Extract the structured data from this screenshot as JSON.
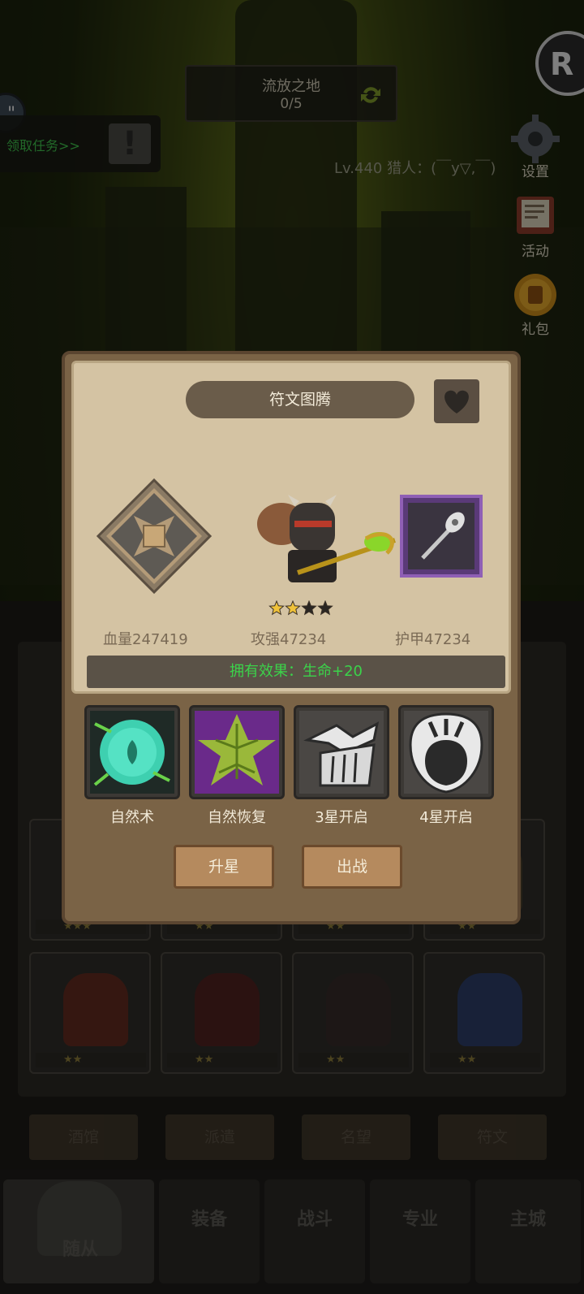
{
  "hud": {
    "location": "流放之地",
    "progress": "0/5",
    "quest_link": "领取任务>>",
    "player_info": "Lv.440  猎人：(￣y▽,￣)"
  },
  "side_buttons": [
    {
      "label": "设置",
      "icon": "gear-icon"
    },
    {
      "label": "活动",
      "icon": "scroll-icon"
    },
    {
      "label": "礼包",
      "icon": "gift-icon"
    }
  ],
  "popup": {
    "title": "符文图腾",
    "stars_filled": 2,
    "stars_total": 4,
    "stats": {
      "hp": "血量247419",
      "attack": "攻强47234",
      "armor": "护甲47234"
    },
    "effect": "拥有效果：生命+20",
    "skills": [
      {
        "label": "自然术",
        "icon": "nature-orb-icon"
      },
      {
        "label": "自然恢复",
        "icon": "leaf-icon"
      },
      {
        "label": "3星开启",
        "icon": "locked-skill-icon"
      },
      {
        "label": "4星开启",
        "icon": "shield-skill-icon"
      }
    ],
    "buttons": {
      "upgrade": "升星",
      "deploy": "出战"
    }
  },
  "tabs": [
    "酒馆",
    "派遣",
    "名望",
    "符文"
  ],
  "nav": [
    {
      "label": "随从"
    },
    {
      "label": "装备"
    },
    {
      "label": "战斗"
    },
    {
      "label": "专业"
    },
    {
      "label": "主城"
    }
  ],
  "colors": {
    "effect_green": "#3bd34a",
    "quest_green": "#3ec04b",
    "parchment": "#d4c3a3",
    "wood": "#7a6346",
    "weapon_rarity": "#8f5fb5"
  }
}
